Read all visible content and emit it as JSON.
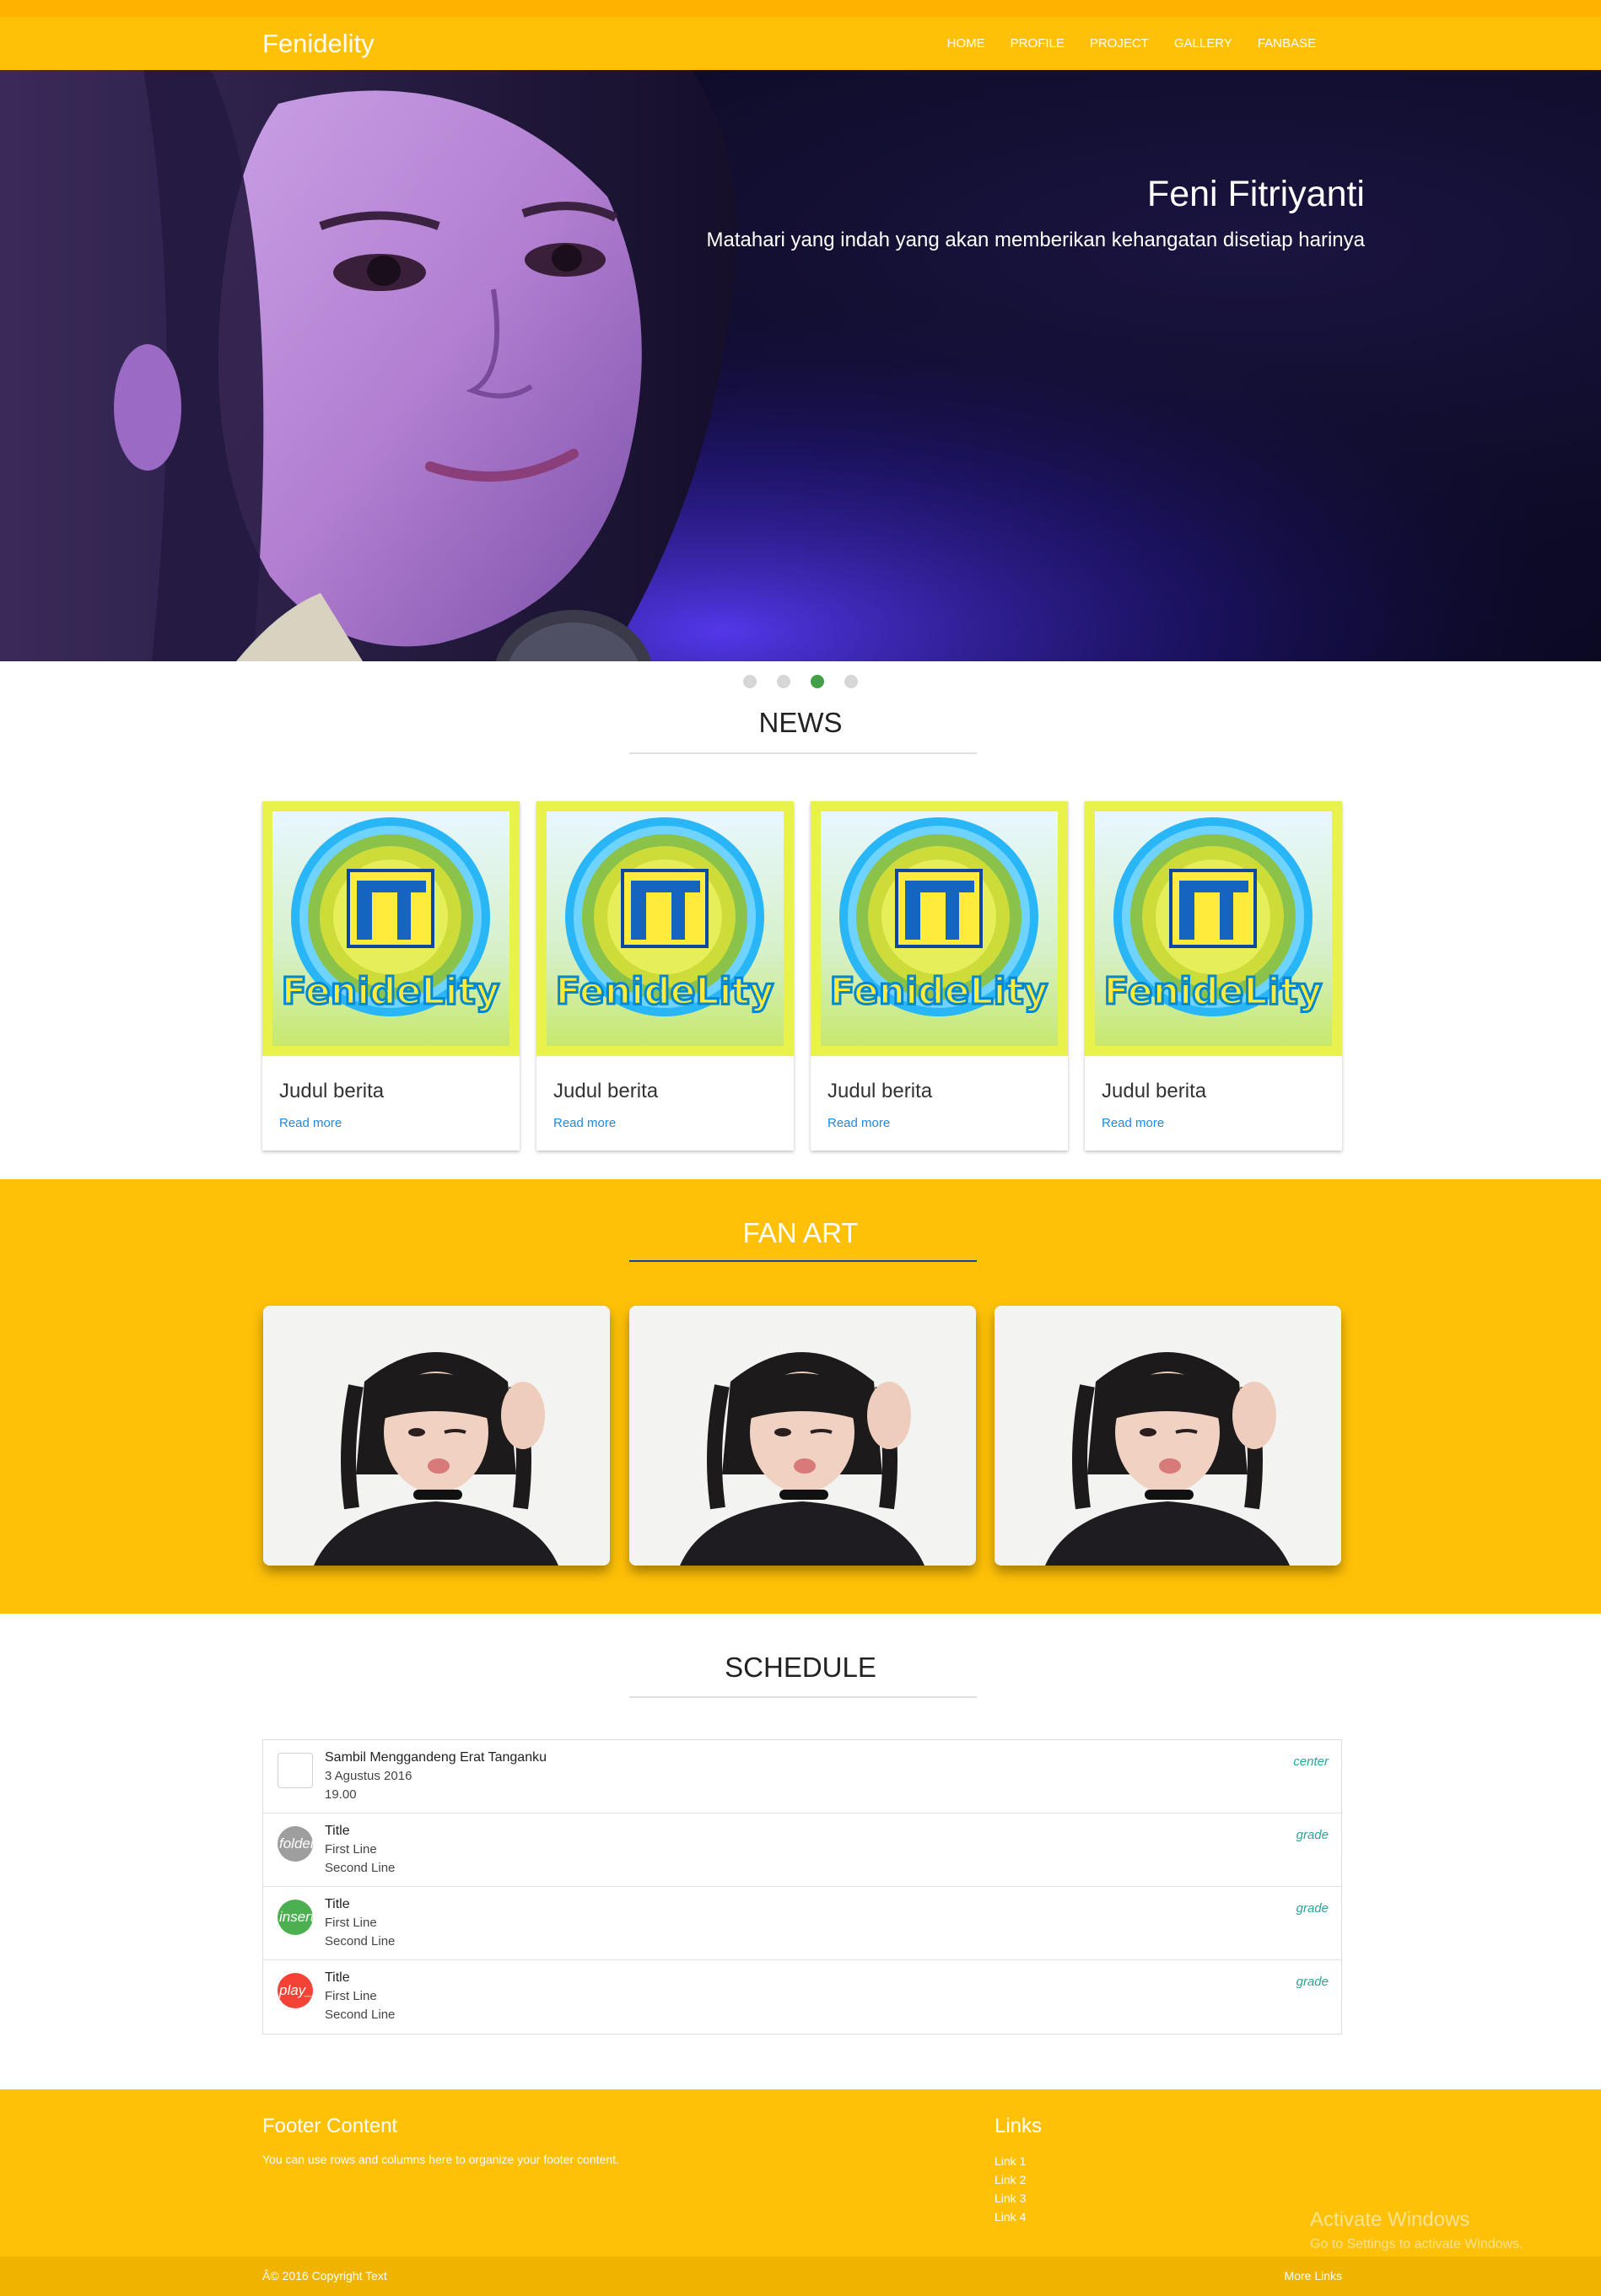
{
  "nav": {
    "brand": "Fenidelity",
    "links": [
      "HOME",
      "PROFILE",
      "PROJECT",
      "GALLERY",
      "FANBASE"
    ]
  },
  "hero": {
    "title": "Feni Fitriyanti",
    "subtitle": "Matahari yang indah yang akan memberikan kehangatan disetiap harinya",
    "slide_count": 4,
    "active_slide": 3
  },
  "news": {
    "heading": "NEWS",
    "cards": [
      {
        "title": "Judul berita",
        "link": "Read more",
        "logo_text": "FenideLity"
      },
      {
        "title": "Judul berita",
        "link": "Read more",
        "logo_text": "FenideLity"
      },
      {
        "title": "Judul berita",
        "link": "Read more",
        "logo_text": "FenideLity"
      },
      {
        "title": "Judul berita",
        "link": "Read more",
        "logo_text": "FenideLity"
      }
    ]
  },
  "fanart": {
    "heading": "FAN ART",
    "count": 3
  },
  "schedule": {
    "heading": "SCHEDULE",
    "items": [
      {
        "avatar": "",
        "avatar_color": "#ffffff",
        "title": "Sambil Menggandeng Erat Tanganku",
        "line1": "3 Agustus 2016",
        "line2": "19.00",
        "secondary": "center"
      },
      {
        "avatar": "folder",
        "avatar_color": "#9e9e9e",
        "title": "Title",
        "line1": "First Line",
        "line2": "Second Line",
        "secondary": "grade"
      },
      {
        "avatar": "insert_chart",
        "avatar_color": "#4caf50",
        "title": "Title",
        "line1": "First Line",
        "line2": "Second Line",
        "secondary": "grade"
      },
      {
        "avatar": "play_arrow",
        "avatar_color": "#f44336",
        "title": "Title",
        "line1": "First Line",
        "line2": "Second Line",
        "secondary": "grade"
      }
    ]
  },
  "footer": {
    "heading": "Footer Content",
    "text": "You can use rows and columns here to organize your footer content.",
    "links_heading": "Links",
    "links": [
      "Link 1",
      "Link 2",
      "Link 3",
      "Link 4"
    ],
    "copyright": "Â© 2016 Copyright Text",
    "more_links": "More Links"
  },
  "watermark": {
    "line1": "Activate Windows",
    "line2": "Go to Settings to activate Windows."
  },
  "colors": {
    "primary": "#ffc107",
    "accent_dot": "#43a047",
    "link": "#1e88e5",
    "secondary_text": "#26a69a"
  }
}
